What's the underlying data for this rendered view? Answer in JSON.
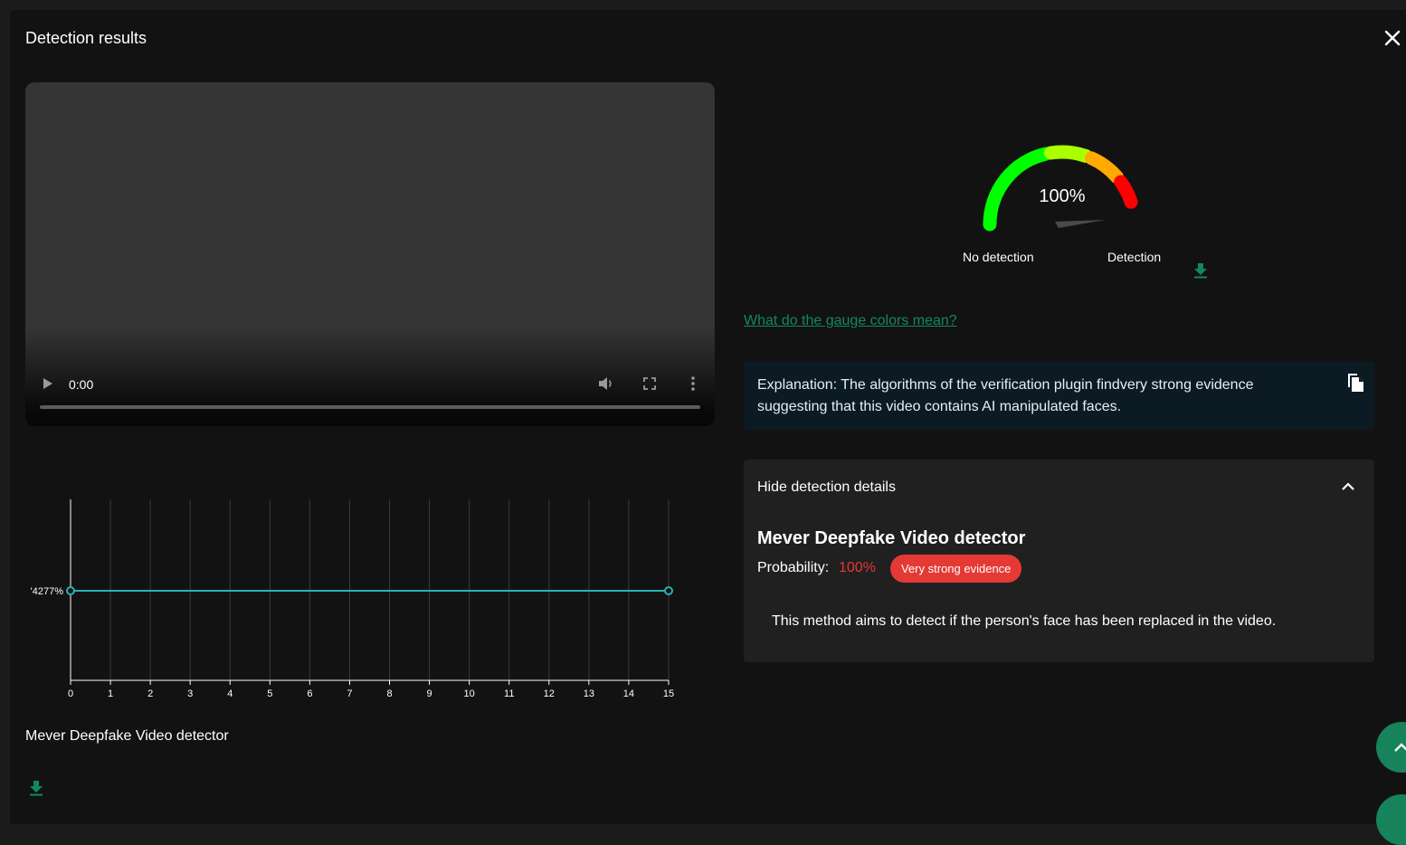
{
  "dialog": {
    "title": "Detection results"
  },
  "video": {
    "time": "0:00"
  },
  "chart_data": {
    "type": "line",
    "x": [
      0,
      1,
      2,
      3,
      4,
      5,
      6,
      7,
      8,
      9,
      10,
      11,
      12,
      13,
      14,
      15
    ],
    "series": [
      {
        "values": [
          100,
          100
        ],
        "x": [
          0,
          15
        ]
      }
    ],
    "xlim": [
      0,
      15
    ],
    "y_tick_label": "'4277%",
    "grid": "vertical",
    "color": "#2ab0b3"
  },
  "timeline": {
    "detector_label": "Mever Deepfake Video detector"
  },
  "gauge": {
    "value_text": "100%",
    "value": 1.0,
    "left_label": "No detection",
    "right_label": "Detection",
    "colors": [
      "#00ff00",
      "#aaff00",
      "#ffaa00",
      "#ff0000"
    ]
  },
  "gauge_link": "What do the gauge colors mean?",
  "explanation": {
    "text": "Explanation: The algorithms of the verification plugin findvery strong evidence suggesting that this video contains AI manipulated faces."
  },
  "details": {
    "toggle_label": "Hide detection details",
    "detector_name": "Mever Deepfake Video detector",
    "probability_label": "Probability:",
    "probability_value": "100%",
    "badge": "Very strong evidence",
    "method_text": "This method aims to detect if the person's face has been replaced in the video."
  },
  "icons": {
    "close": "close-icon",
    "download": "download-icon",
    "copy": "copy-icon",
    "chevron": "chevron-up-icon"
  },
  "theme": {
    "accent": "#13885f",
    "danger": "#e53935"
  }
}
